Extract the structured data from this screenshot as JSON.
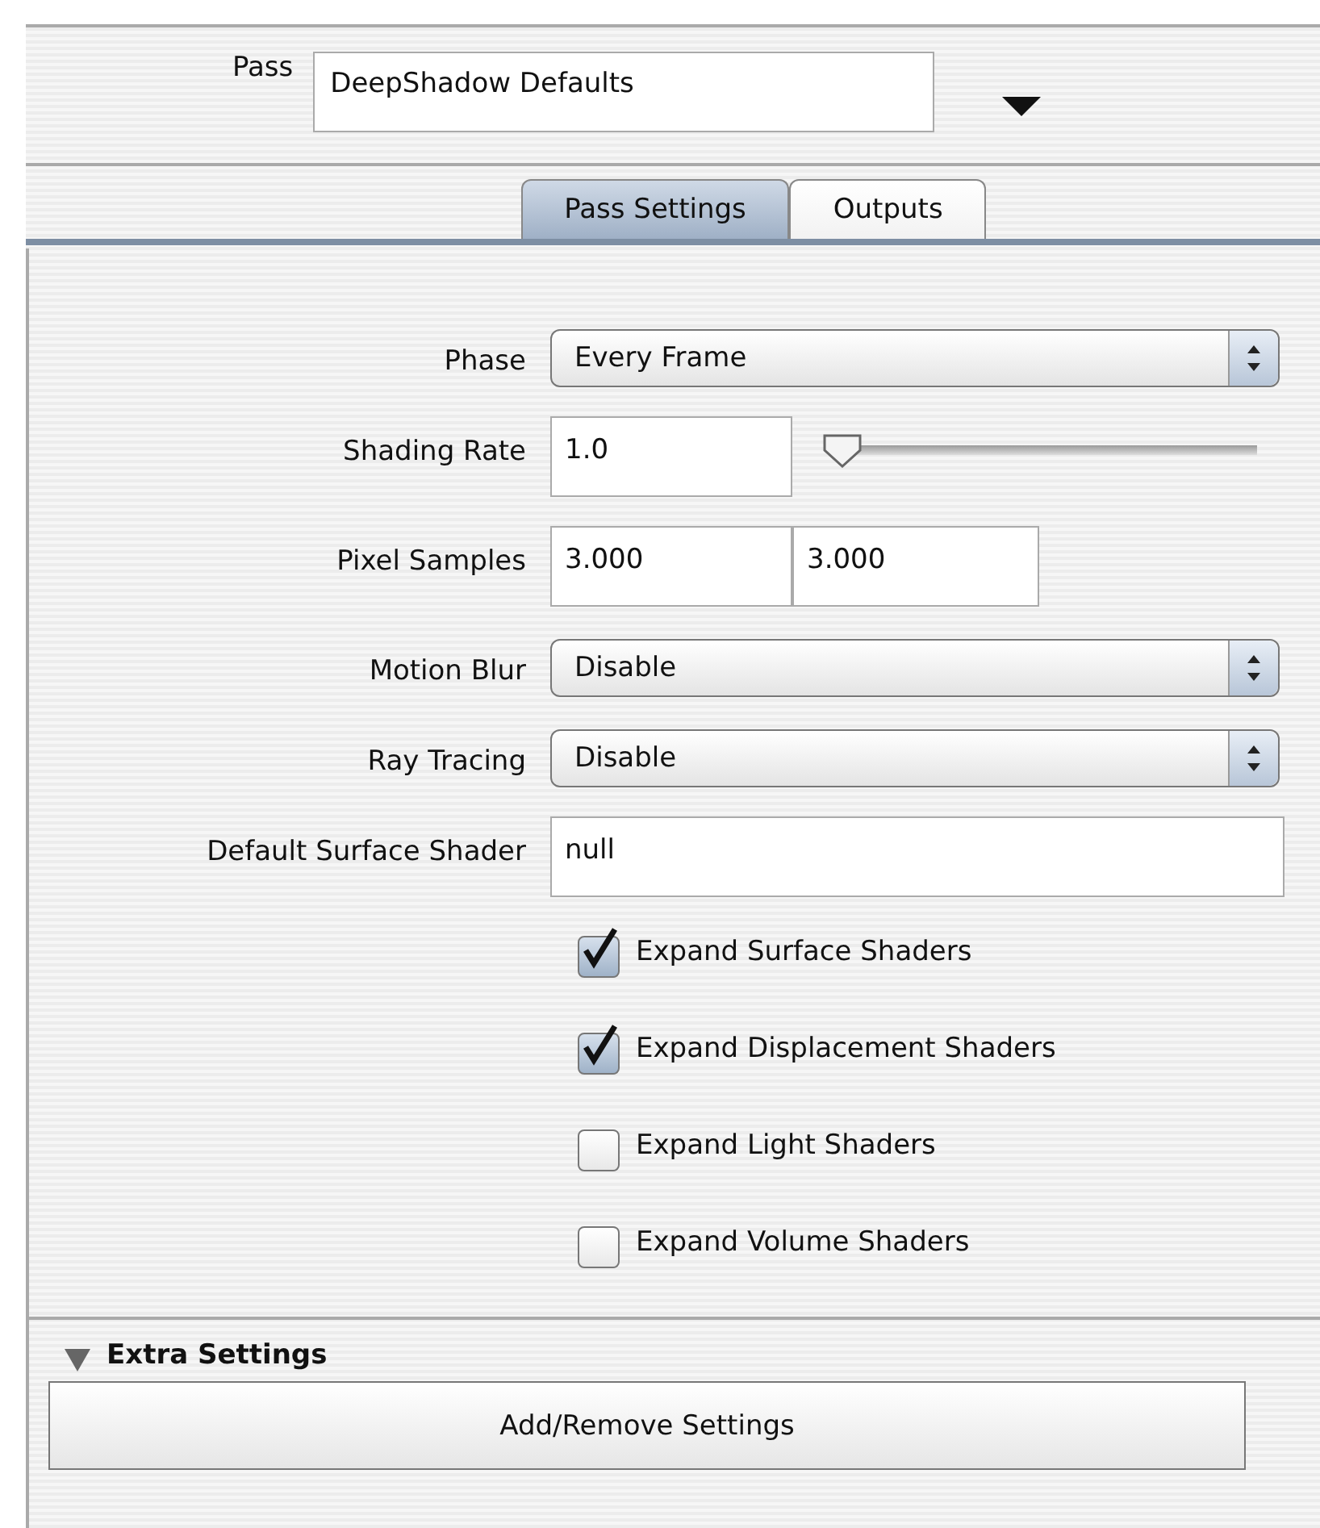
{
  "pass": {
    "label": "Pass",
    "value": "DeepShadow Defaults"
  },
  "tabs": [
    {
      "label": "Pass Settings",
      "selected": true
    },
    {
      "label": "Outputs",
      "selected": false
    }
  ],
  "fields": [
    {
      "kind": "select",
      "label": "Phase",
      "value": "Every Frame"
    },
    {
      "kind": "slider",
      "label": "Shading Rate",
      "value": "1.0",
      "level": 0.03
    },
    {
      "kind": "pair",
      "label": "Pixel Samples",
      "values": [
        "3.000",
        "3.000"
      ]
    },
    {
      "kind": "select",
      "label": "Motion Blur",
      "value": "Disable"
    },
    {
      "kind": "select",
      "label": "Ray Tracing",
      "value": "Disable"
    },
    {
      "kind": "text",
      "label": "Default Surface Shader",
      "value": "null"
    }
  ],
  "checkboxes": [
    {
      "label": "Expand Surface Shaders",
      "checked": true
    },
    {
      "label": "Expand Displacement Shaders",
      "checked": true
    },
    {
      "label": "Expand Light Shaders",
      "checked": false
    },
    {
      "label": "Expand Volume Shaders",
      "checked": false
    }
  ],
  "extra": {
    "title": "Extra Settings",
    "expanded": true,
    "button": "Add/Remove Settings"
  }
}
